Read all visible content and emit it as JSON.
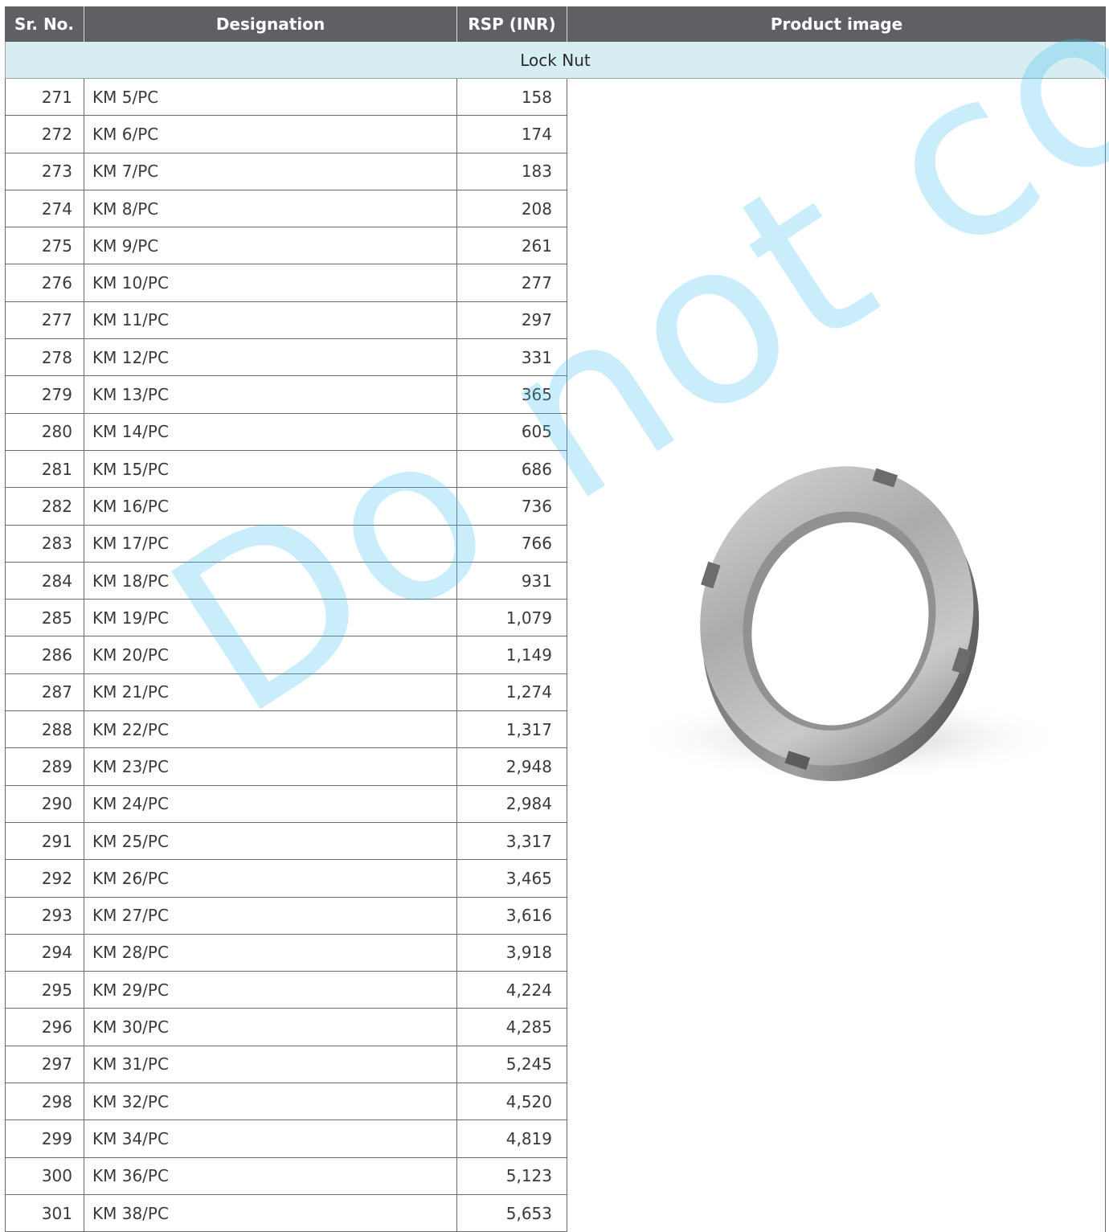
{
  "table": {
    "headers": {
      "sr_no": "Sr. No.",
      "designation": "Designation",
      "rsp": "RSP (INR)",
      "product_image": "Product image"
    },
    "section_title": "Lock Nut",
    "rows": [
      {
        "sr": "271",
        "designation": "KM 5/PC",
        "rsp": "158"
      },
      {
        "sr": "272",
        "designation": "KM 6/PC",
        "rsp": "174"
      },
      {
        "sr": "273",
        "designation": "KM 7/PC",
        "rsp": "183"
      },
      {
        "sr": "274",
        "designation": "KM 8/PC",
        "rsp": "208"
      },
      {
        "sr": "275",
        "designation": "KM 9/PC",
        "rsp": "261"
      },
      {
        "sr": "276",
        "designation": "KM 10/PC",
        "rsp": "277"
      },
      {
        "sr": "277",
        "designation": "KM 11/PC",
        "rsp": "297"
      },
      {
        "sr": "278",
        "designation": "KM 12/PC",
        "rsp": "331"
      },
      {
        "sr": "279",
        "designation": "KM 13/PC",
        "rsp": "365"
      },
      {
        "sr": "280",
        "designation": "KM 14/PC",
        "rsp": "605"
      },
      {
        "sr": "281",
        "designation": "KM 15/PC",
        "rsp": "686"
      },
      {
        "sr": "282",
        "designation": "KM 16/PC",
        "rsp": "736"
      },
      {
        "sr": "283",
        "designation": "KM 17/PC",
        "rsp": "766"
      },
      {
        "sr": "284",
        "designation": "KM 18/PC",
        "rsp": "931"
      },
      {
        "sr": "285",
        "designation": "KM 19/PC",
        "rsp": "1,079"
      },
      {
        "sr": "286",
        "designation": "KM 20/PC",
        "rsp": "1,149"
      },
      {
        "sr": "287",
        "designation": "KM 21/PC",
        "rsp": "1,274"
      },
      {
        "sr": "288",
        "designation": "KM 22/PC",
        "rsp": "1,317"
      },
      {
        "sr": "289",
        "designation": "KM 23/PC",
        "rsp": "2,948"
      },
      {
        "sr": "290",
        "designation": "KM 24/PC",
        "rsp": "2,984"
      },
      {
        "sr": "291",
        "designation": "KM 25/PC",
        "rsp": "3,317"
      },
      {
        "sr": "292",
        "designation": "KM 26/PC",
        "rsp": "3,465"
      },
      {
        "sr": "293",
        "designation": "KM 27/PC",
        "rsp": "3,616"
      },
      {
        "sr": "294",
        "designation": "KM 28/PC",
        "rsp": "3,918"
      },
      {
        "sr": "295",
        "designation": "KM 29/PC",
        "rsp": "4,224"
      },
      {
        "sr": "296",
        "designation": "KM 30/PC",
        "rsp": "4,285"
      },
      {
        "sr": "297",
        "designation": "KM 31/PC",
        "rsp": "5,245"
      },
      {
        "sr": "298",
        "designation": "KM 32/PC",
        "rsp": "4,520"
      },
      {
        "sr": "299",
        "designation": "KM 34/PC",
        "rsp": "4,819"
      },
      {
        "sr": "300",
        "designation": "KM 36/PC",
        "rsp": "5,123"
      },
      {
        "sr": "301",
        "designation": "KM 38/PC",
        "rsp": "5,653"
      }
    ]
  },
  "product_image": {
    "icon": "lock-nut-image"
  },
  "watermark": {
    "text": "Do not copy",
    "color": "#3cbef0"
  },
  "colors": {
    "header_bg": "#5f6063",
    "section_bg": "#d6eef1"
  }
}
